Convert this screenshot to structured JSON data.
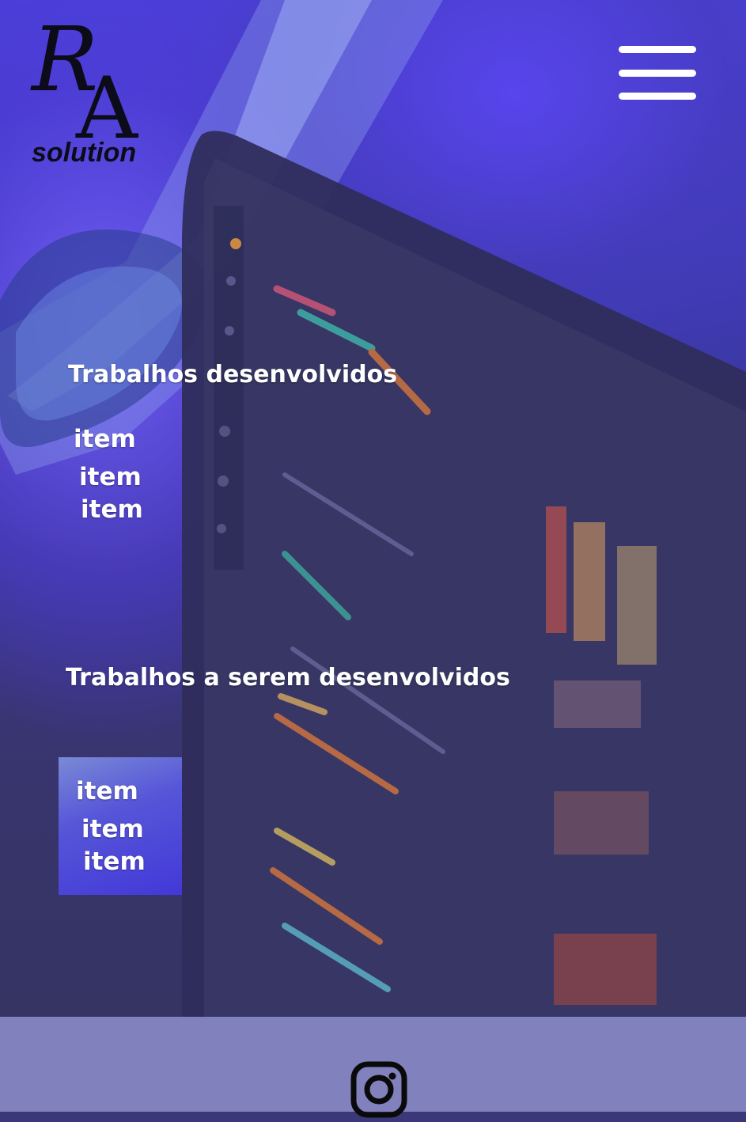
{
  "logo": {
    "letter_r": "R",
    "letter_a": "A",
    "subtitle": "solution"
  },
  "menu": {
    "icon": "hamburger-menu-icon"
  },
  "sections": {
    "developed": {
      "title": "Trabalhos desenvolvidos",
      "items": [
        "item",
        "item",
        "item"
      ]
    },
    "to_develop": {
      "title": "Trabalhos a serem desenvolvidos",
      "items": [
        "item",
        "item",
        "item"
      ]
    }
  },
  "footer": {
    "social_icon": "instagram-icon"
  },
  "colors": {
    "footer_bg": "#8181bd",
    "text": "#ffffff",
    "logo": "#0b0b1a"
  }
}
